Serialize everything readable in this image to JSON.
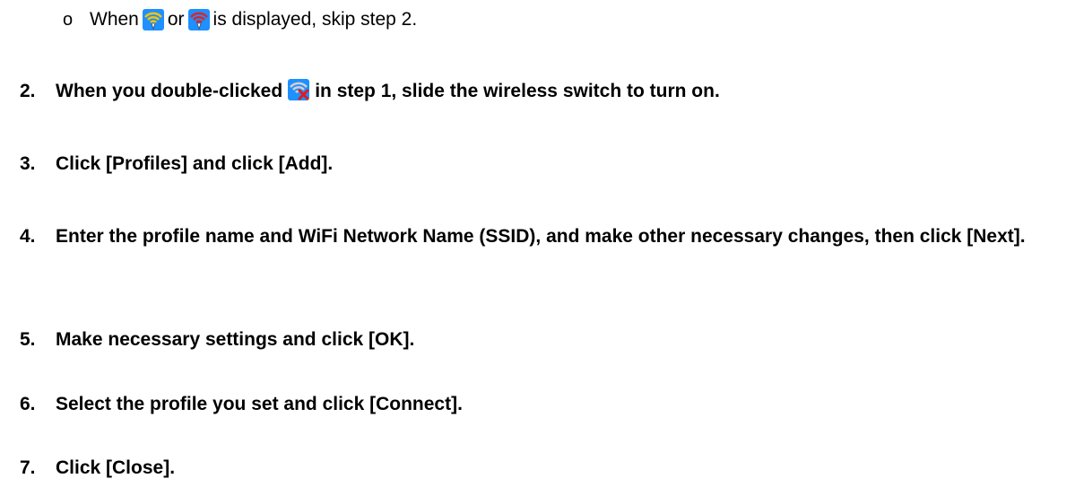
{
  "bullet": {
    "marker": "o",
    "part1": "When",
    "icon1": "wifi-signal-yellow-icon",
    "part2": "or",
    "icon2": "wifi-signal-red-icon",
    "part3": "is displayed, skip step 2."
  },
  "steps": [
    {
      "num": "2.",
      "before": "When you double-clicked",
      "icon": "wifi-disabled-icon",
      "after": "in step 1, slide the wireless switch to turn on."
    },
    {
      "num": "3.",
      "text": "Click [Profiles] and click [Add]."
    },
    {
      "num": "4.",
      "text": "Enter the profile name and WiFi Network Name (SSID), and make other necessary changes, then click [Next]."
    },
    {
      "num": "5.",
      "text": "Make necessary settings and click [OK]."
    },
    {
      "num": "6.",
      "text": "Select the profile you set and click [Connect]."
    },
    {
      "num": "7.",
      "text": "Click [Close]."
    }
  ],
  "colors": {
    "icon_bg": "#1e90ff",
    "signal_yellow": "#f5c400",
    "signal_red": "#d8262a",
    "disabled_gray": "#d0d0d0",
    "x_red": "#e01b1b"
  }
}
